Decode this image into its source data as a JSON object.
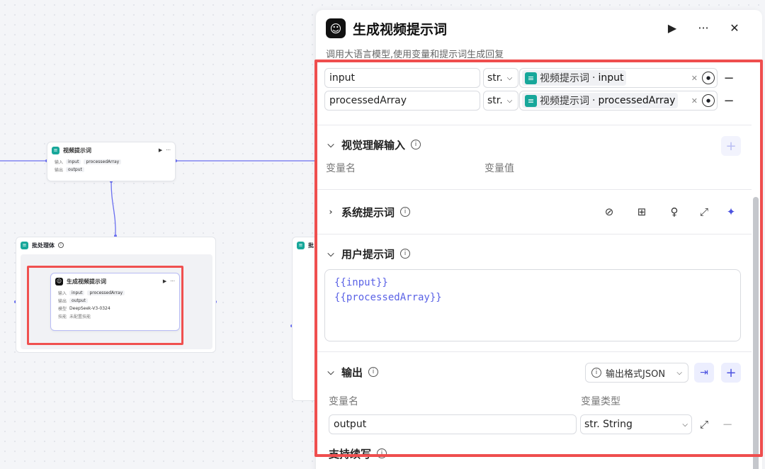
{
  "canvas": {
    "node_video_prompt": {
      "title": "视频提示词",
      "input_label": "输入",
      "inputs": [
        "input",
        "processedArray"
      ],
      "output_label": "输出",
      "outputs": [
        "output"
      ]
    },
    "batch_group": {
      "title": "批处理体"
    },
    "batch_group_right": {
      "title": "批"
    },
    "node_generate": {
      "title": "生成视频提示词",
      "input_label": "输入",
      "inputs": [
        "input",
        "processedArray"
      ],
      "output_label": "输出",
      "outputs": [
        "output"
      ],
      "model_label": "模型",
      "model": "DeepSeek-V3-0324",
      "skill_label": "技能",
      "skill": "未配置技能"
    }
  },
  "panel": {
    "title": "生成视频提示词",
    "description": "调用大语言模型,使用变量和提示词生成回复",
    "inputs": [
      {
        "name": "input",
        "type": "str.",
        "ref_node": "视频提示词",
        "ref_var": "input"
      },
      {
        "name": "processedArray",
        "type": "str.",
        "ref_node": "视频提示词",
        "ref_var": "processedArray"
      }
    ],
    "vision": {
      "title": "视觉理解输入",
      "col_name": "变量名",
      "col_value": "变量值"
    },
    "system_prompt": {
      "title": "系统提示词"
    },
    "user_prompt": {
      "title": "用户提示词",
      "lines": [
        "{{input}}",
        "{{processedArray}}"
      ]
    },
    "output": {
      "title": "输出",
      "format_label": "输出格式JSON",
      "col_name": "变量名",
      "col_type": "变量类型",
      "rows": [
        {
          "name": "output",
          "type": "str. String"
        }
      ]
    },
    "continuation": {
      "title": "支持续写"
    }
  }
}
